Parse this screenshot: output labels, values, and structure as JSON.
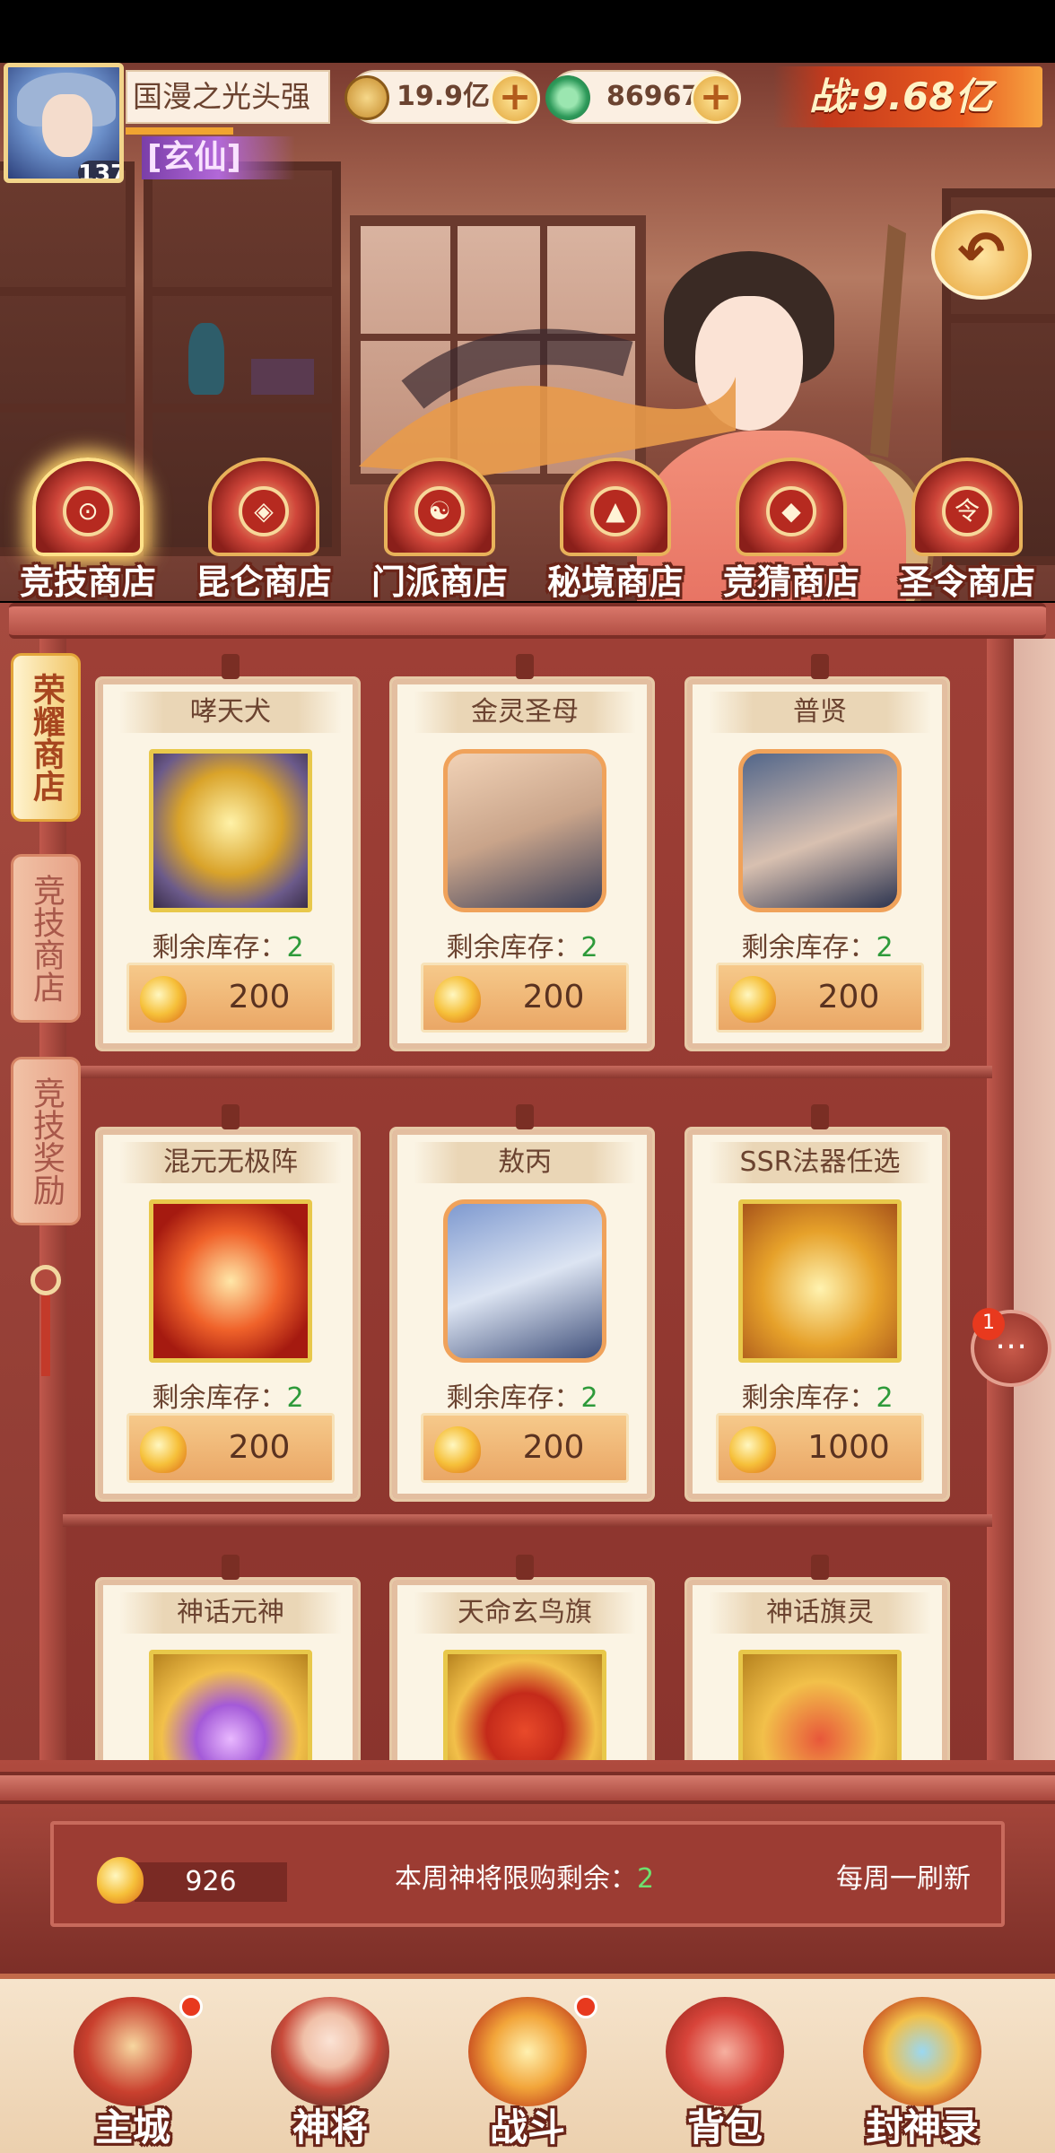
{
  "player": {
    "name": "国漫之光头强",
    "level": "137",
    "title": "[玄仙]",
    "power": "战:9.68亿"
  },
  "resources": {
    "coins": "19.9亿",
    "jade": "86967"
  },
  "shop_tabs": [
    {
      "label": "竞技商店",
      "icon": "arena-shop-icon",
      "active": true
    },
    {
      "label": "昆仑商店",
      "icon": "kunlun-shop-icon",
      "active": false
    },
    {
      "label": "门派商店",
      "icon": "sect-shop-icon",
      "active": false
    },
    {
      "label": "秘境商店",
      "icon": "secret-realm-shop-icon",
      "active": false
    },
    {
      "label": "竞猜商店",
      "icon": "guess-shop-icon",
      "active": false
    },
    {
      "label": "圣令商店",
      "icon": "holy-order-shop-icon",
      "active": false
    }
  ],
  "side_tabs": [
    {
      "label": "荣耀商店",
      "active": true
    },
    {
      "label": "竞技商店",
      "active": false
    },
    {
      "label": "竞技奖励",
      "active": false
    }
  ],
  "items": [
    {
      "name": "哮天犬",
      "stock_label": "剩余库存：",
      "stock": "2",
      "price": "200",
      "art": "xiaotianquan-wolf",
      "frame": "gold"
    },
    {
      "name": "金灵圣母",
      "stock_label": "剩余库存：",
      "stock": "2",
      "price": "200",
      "art": "jinling-shengmu-portrait",
      "frame": "orange"
    },
    {
      "name": "普贤",
      "stock_label": "剩余库存：",
      "stock": "2",
      "price": "200",
      "art": "puxian-portrait",
      "frame": "orange"
    },
    {
      "name": "混元无极阵",
      "stock_label": "剩余库存：",
      "stock": "2",
      "price": "200",
      "art": "hunyuan-array",
      "frame": "gold"
    },
    {
      "name": "敖丙",
      "stock_label": "剩余库存：",
      "stock": "2",
      "price": "200",
      "art": "aobing-portrait",
      "frame": "orange"
    },
    {
      "name": "SSR法器任选",
      "stock_label": "剩余库存：",
      "stock": "2",
      "price": "1000",
      "art": "treasure-chest",
      "frame": "gold"
    },
    {
      "name": "神话元神",
      "art": "mythic-spirit-orb",
      "frame": "gold"
    },
    {
      "name": "天命玄鸟旗",
      "art": "xuanniao-banner",
      "frame": "gold"
    },
    {
      "name": "神话旗灵",
      "art": "mythic-flag-scroll",
      "frame": "gold"
    }
  ],
  "footer_info": {
    "currency": "926",
    "limit_label": "本周神将限购剩余：",
    "limit_value": "2",
    "refresh_text": "每周一刷新"
  },
  "chat_badge": "1",
  "bottom_nav": [
    {
      "label": "主城",
      "icon": "main-city-icon",
      "badge": true
    },
    {
      "label": "神将",
      "icon": "heroes-icon",
      "badge": false
    },
    {
      "label": "战斗",
      "icon": "battle-icon",
      "badge": true
    },
    {
      "label": "背包",
      "icon": "backpack-icon",
      "badge": false
    },
    {
      "label": "封神录",
      "icon": "fengshen-record-icon",
      "badge": false
    }
  ],
  "colors": {
    "stock_green": "#2e9a3a",
    "cabinet_red": "#9e3f36",
    "card_bg": "#fbf4e4"
  }
}
